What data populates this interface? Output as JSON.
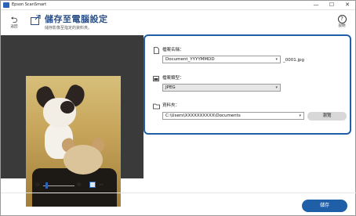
{
  "window": {
    "title": "Epson ScanSmart",
    "controls": [
      "—",
      "☐",
      "✕"
    ]
  },
  "header": {
    "back_label": "返回",
    "title": "儲存至電腦設定",
    "subtitle": "儲存影像至指定的資料夾。",
    "help_label": "說明"
  },
  "form": {
    "filename_label": "檔案名稱：",
    "filename_value": "Document_YYYYMMDD",
    "filename_suffix": "_0001.jpg",
    "filetype_label": "檔案類型：",
    "filetype_value": "JPEG",
    "folder_label": "資料夾：",
    "folder_value": "C:\\Users\\XXXXXXXXXX\\Documents",
    "browse_label": "瀏覽"
  },
  "preview": {
    "zoom_out": "⊖",
    "zoom_in": "⊕",
    "rotate": "↔"
  },
  "footer": {
    "save_label": "儲存"
  },
  "colors": {
    "accent": "#1f5fa8",
    "title": "#2a4f86"
  }
}
